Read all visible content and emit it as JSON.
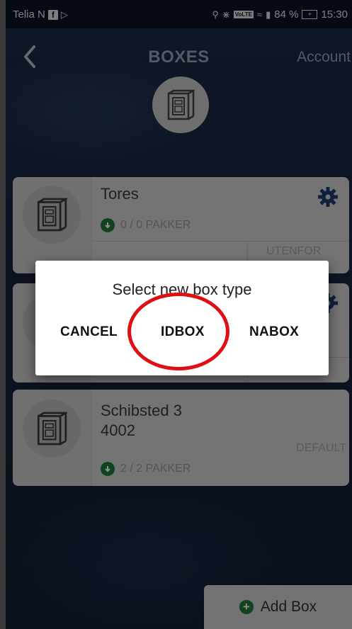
{
  "status_bar": {
    "carrier": "Telia N",
    "battery": "84 %",
    "time": "15:30"
  },
  "header": {
    "title": "BOXES",
    "account_label": "Account"
  },
  "boxes": [
    {
      "name": "Tores",
      "pakker": "0 / 0 PAKKER",
      "tag": "UTENFOR"
    },
    {
      "name": "",
      "pakker": "",
      "tag": ""
    },
    {
      "name": "Schibsted 3\n4002",
      "name_line1": "Schibsted 3",
      "name_line2": "4002",
      "pakker": "2 / 2 PAKKER",
      "tag": "DEFAULT"
    }
  ],
  "dialog": {
    "title": "Select new box type",
    "cancel": "CANCEL",
    "idbox": "IDBOX",
    "nabox": "NABOX"
  },
  "add_box": {
    "label": "Add Box"
  },
  "colors": {
    "accent_green": "#1f7a3a",
    "gear_blue": "#1d3d6e",
    "highlight_red": "#e00f14"
  },
  "icons": [
    "back-chevron-icon",
    "box-icon",
    "gear-icon",
    "check-circle-icon",
    "plus-circle-icon"
  ]
}
